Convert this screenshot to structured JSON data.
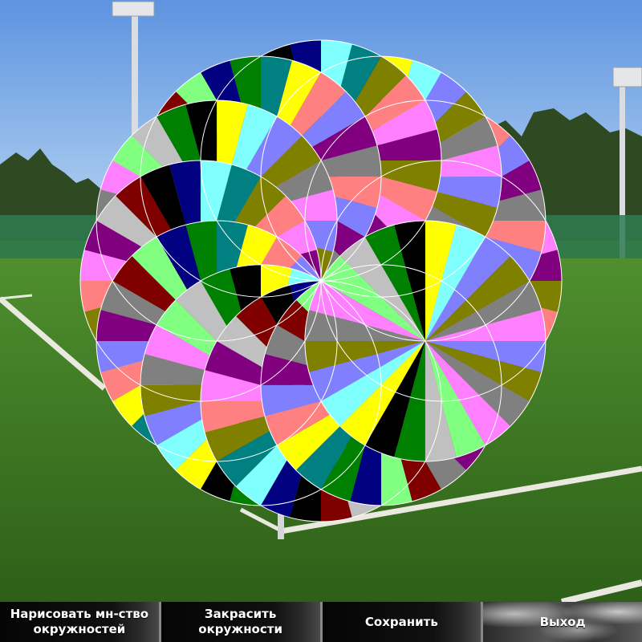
{
  "toolbar": {
    "buttons": [
      {
        "label": "Нарисовать мн-ство\nокружностей"
      },
      {
        "label": "Закрасить\nокружности"
      },
      {
        "label": "Сохранить"
      },
      {
        "label": "Выход"
      }
    ]
  },
  "palette": {
    "sky_top": "#5d93e0",
    "sky_bottom": "#b9d6f2",
    "grass_light": "#4f8f2e",
    "grass_dark": "#2d5f18",
    "field_line": "#e9e9e0",
    "rosette_stroke": "#ffffff",
    "region_colors": [
      "#800080",
      "#808000",
      "#ffff00",
      "#000080",
      "#c0c0c0",
      "#808080",
      "#ff8080",
      "#80ffff",
      "#008000",
      "#800000",
      "#ff80ff",
      "#8080ff",
      "#008080",
      "#000000",
      "#80ff80"
    ]
  },
  "rosette": {
    "circle_count": 12
  }
}
